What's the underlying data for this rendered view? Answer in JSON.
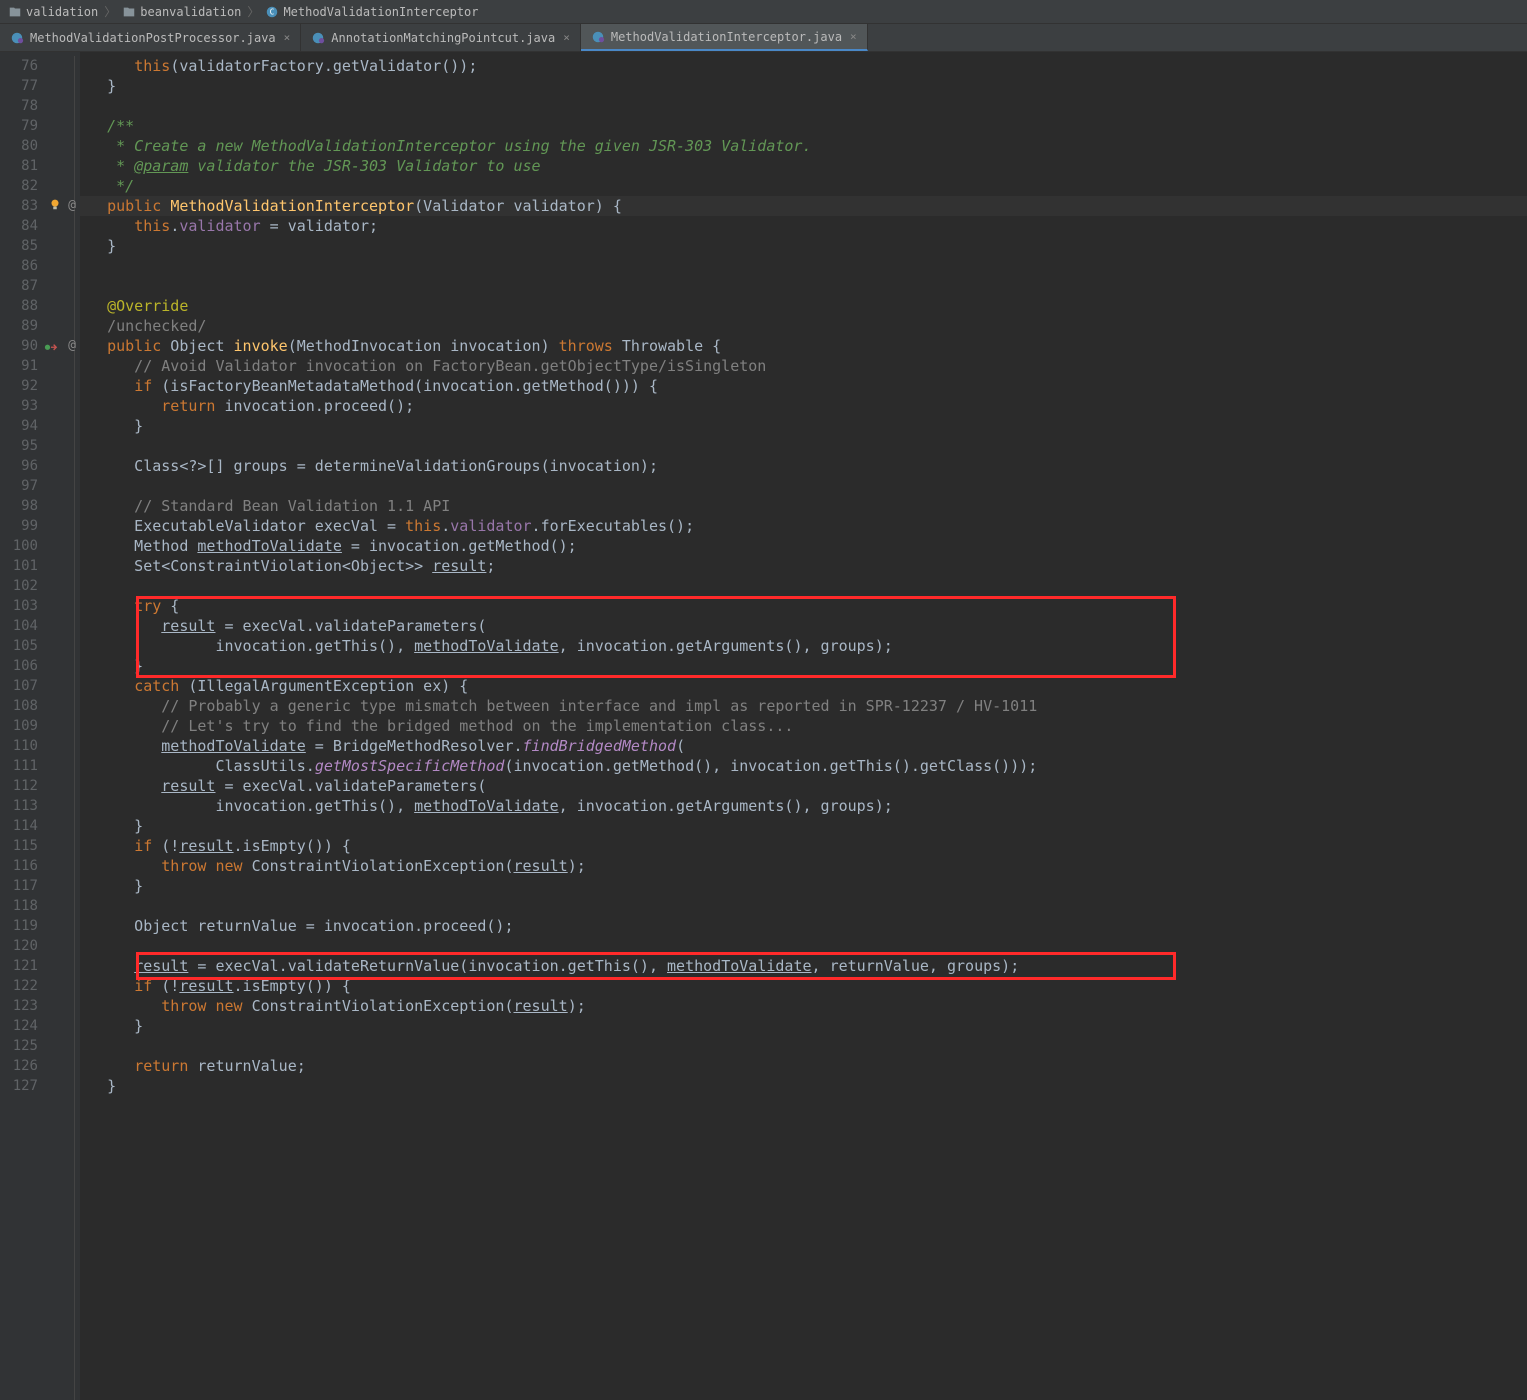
{
  "breadcrumb": {
    "items": [
      "validation",
      "beanvalidation",
      "MethodValidationInterceptor"
    ]
  },
  "tabs": [
    {
      "label": "MethodValidationPostProcessor.java",
      "active": false
    },
    {
      "label": "AnnotationMatchingPointcut.java",
      "active": false
    },
    {
      "label": "MethodValidationInterceptor.java",
      "active": true
    }
  ],
  "gutter": {
    "start": 76,
    "end": 127,
    "marks": {
      "83": {
        "at": true,
        "bulb": true
      },
      "90": {
        "at": true,
        "impl": true
      }
    }
  },
  "code": {
    "76": [
      [
        "      ",
        "p"
      ],
      [
        "this",
        "kw"
      ],
      [
        ".",
        "p"
      ],
      [
        "(validatorFactory.getValidator());",
        "p"
      ]
    ],
    "l76": "      this(validatorFactory.getValidator());",
    "l77": "   }",
    "l78": "",
    "l79": "   /**",
    "l80": "    * Create a new MethodValidationInterceptor using the given JSR-303 Validator.",
    "l81_a": "    * ",
    "l81_b": "@param",
    "l81_c": " validator the JSR-303 Validator to use",
    "l82": "    */",
    "l83_a": "   ",
    "l83_b": "public",
    "l83_c": " ",
    "l83_d": "MethodValidationInterceptor",
    "l83_e": "(Validator validator) {",
    "l84_a": "      ",
    "l84_b": "this",
    "l84_c": ".",
    "l84_d": "validator",
    "l84_e": " = validator;",
    "l85": "   }",
    "l86": "",
    "l87": "",
    "l88": "   @Override",
    "l89": "   /unchecked/",
    "l90_a": "   ",
    "l90_b": "public",
    "l90_c": " Object ",
    "l90_d": "invoke",
    "l90_e": "(MethodInvocation invocation) ",
    "l90_f": "throws",
    "l90_g": " Throwable {",
    "l91": "      // Avoid Validator invocation on FactoryBean.getObjectType/isSingleton",
    "l92_a": "      ",
    "l92_b": "if",
    "l92_c": " (isFactoryBeanMetadataMethod(invocation.getMethod())) {",
    "l93_a": "         ",
    "l93_b": "return",
    "l93_c": " invocation.proceed();",
    "l94": "      }",
    "l95": "",
    "l96": "      Class<?>[] groups = determineValidationGroups(invocation);",
    "l97": "",
    "l98": "      // Standard Bean Validation 1.1 API",
    "l99_a": "      ExecutableValidator execVal = ",
    "l99_b": "this",
    "l99_c": ".",
    "l99_d": "validator",
    "l99_e": ".forExecutables();",
    "l100_a": "      Method ",
    "l100_b": "methodToValidate",
    "l100_c": " = invocation.getMethod();",
    "l101_a": "      Set<ConstraintViolation<Object>> ",
    "l101_b": "result",
    "l101_c": ";",
    "l102": "",
    "l103_a": "      ",
    "l103_b": "try",
    "l103_c": " {",
    "l104_a": "         ",
    "l104_b": "result",
    "l104_c": " = execVal.validateParameters(",
    "l105_a": "               invocation.getThis(), ",
    "l105_b": "methodToValidate",
    "l105_c": ", invocation.getArguments(), groups);",
    "l106": "      }",
    "l107_a": "      ",
    "l107_b": "catch",
    "l107_c": " (IllegalArgumentException ex) {",
    "l108": "         // Probably a generic type mismatch between interface and impl as reported in SPR-12237 / HV-1011",
    "l109": "         // Let's try to find the bridged method on the implementation class...",
    "l110_a": "         ",
    "l110_b": "methodToValidate",
    "l110_c": " = BridgeMethodResolver.",
    "l110_d": "findBridgedMethod",
    "l110_e": "(",
    "l111_a": "               ClassUtils.",
    "l111_b": "getMostSpecificMethod",
    "l111_c": "(invocation.getMethod(), invocation.getThis().getClass()));",
    "l112_a": "         ",
    "l112_b": "result",
    "l112_c": " = execVal.validateParameters(",
    "l113_a": "               invocation.getThis(), ",
    "l113_b": "methodToValidate",
    "l113_c": ", invocation.getArguments(), groups);",
    "l114": "      }",
    "l115_a": "      ",
    "l115_b": "if",
    "l115_c": " (!",
    "l115_d": "result",
    "l115_e": ".isEmpty()) {",
    "l116_a": "         ",
    "l116_b": "throw new",
    "l116_c": " ConstraintViolationException(",
    "l116_d": "result",
    "l116_e": ");",
    "l117": "      }",
    "l118": "",
    "l119": "      Object returnValue = invocation.proceed();",
    "l120": "",
    "l121_a": "      ",
    "l121_b": "result",
    "l121_c": " = execVal.validateReturnValue(invocation.getThis(), ",
    "l121_d": "methodToValidate",
    "l121_e": ", returnValue, groups);",
    "l122_a": "      ",
    "l122_b": "if",
    "l122_c": " (!",
    "l122_d": "result",
    "l122_e": ".isEmpty()) {",
    "l123_a": "         ",
    "l123_b": "throw new",
    "l123_c": " ConstraintViolationException(",
    "l123_d": "result",
    "l123_e": ");",
    "l124": "      }",
    "l125": "",
    "l126_a": "      ",
    "l126_b": "return",
    "l126_c": " returnValue;",
    "l127": "   }"
  }
}
